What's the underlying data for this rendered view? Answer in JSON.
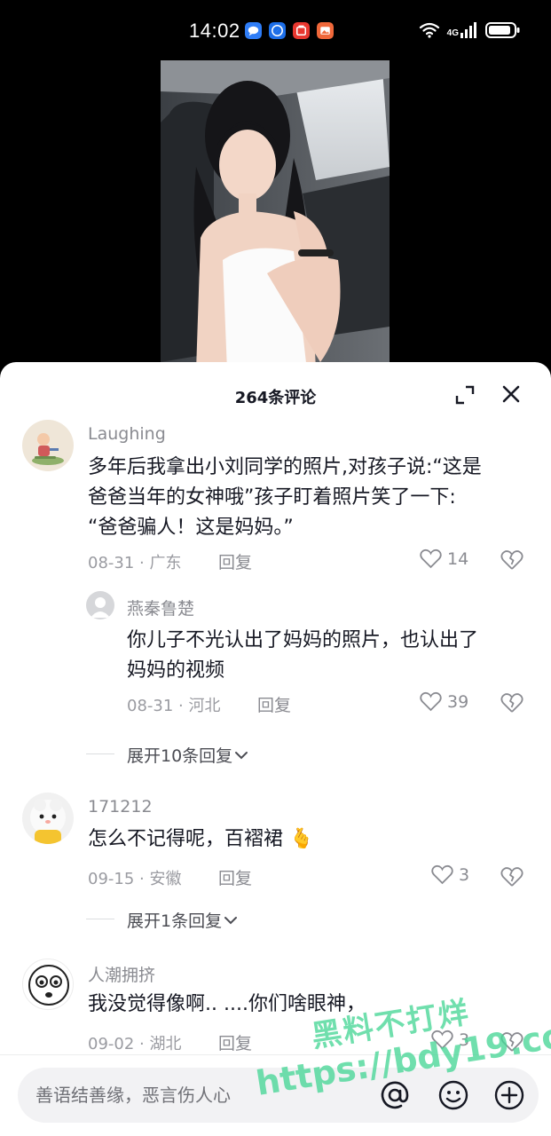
{
  "status_bar": {
    "time": "14:02",
    "network": "4G",
    "app_icons": [
      "message-app-icon",
      "browser-app-icon",
      "shopping-app-icon",
      "gallery-app-icon"
    ]
  },
  "sheet": {
    "title": "264条评论"
  },
  "comments": [
    {
      "user": "Laughing",
      "text_lines": [
        "多年后我拿出小刘同学的照片,对孩子说:“这是",
        "爸爸当年的女神哦”孩子盯着照片笑了一下:",
        "“爸爸骗人！这是妈妈。”"
      ],
      "meta": "08-31 · 广东",
      "reply_label": "回复",
      "likes": "14"
    },
    {
      "user": "燕秦鲁楚",
      "text_lines": [
        "你儿子不光认出了妈妈的照片，也认出了",
        "妈妈的视频"
      ],
      "meta": "08-31 · 河北",
      "reply_label": "回复",
      "likes": "39"
    },
    {
      "user": "171212",
      "text_lines": [
        "怎么不记得呢，百褶裙 🫰"
      ],
      "meta": "09-15 · 安徽",
      "reply_label": "回复",
      "likes": "3"
    },
    {
      "user": "人潮拥挤",
      "text_lines": [
        "我没觉得像啊..  ....你们啥眼神，"
      ],
      "meta": "09-02 · 湖北",
      "reply_label": "回复",
      "likes": "3"
    }
  ],
  "more_replies": [
    {
      "label": "展开10条回复"
    },
    {
      "label": "展开1条回复"
    }
  ],
  "input": {
    "placeholder": "善语结善缘，恶言伤人心"
  },
  "watermark": {
    "line1": "黑料不打烊",
    "line2": "https://bdy19.co"
  },
  "colors": {
    "text_primary": "#161823",
    "text_secondary": "#8a8b91",
    "watermark": "#48d696"
  }
}
